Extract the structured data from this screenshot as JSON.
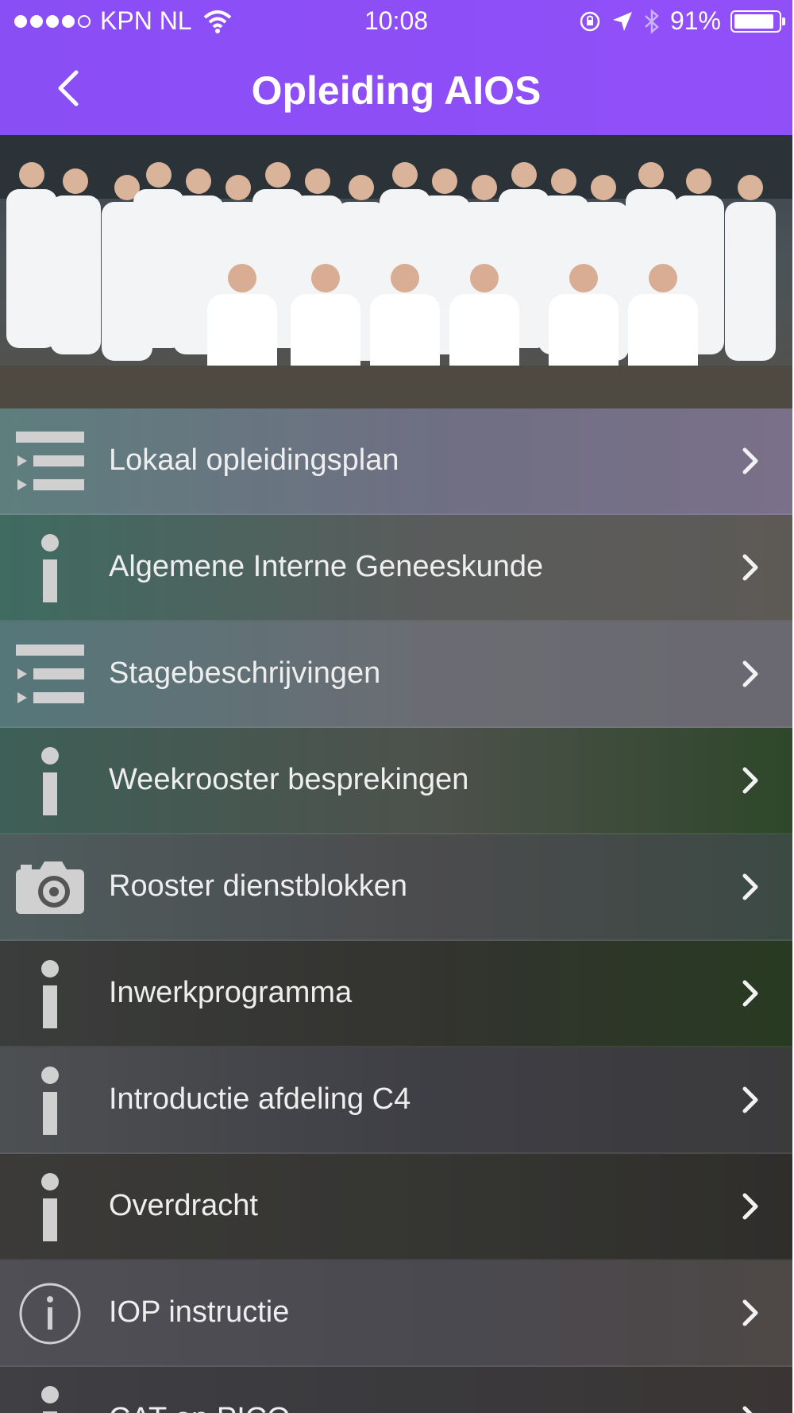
{
  "status_bar": {
    "carrier": "KPN NL",
    "time": "10:08",
    "battery_percent": "91%",
    "battery_level": 0.91,
    "signal_bars_filled": 4,
    "signal_bars_total": 5
  },
  "nav": {
    "title": "Opleiding AIOS"
  },
  "menu": {
    "items": [
      {
        "label": "Lokaal opleidingsplan",
        "icon": "list-icon"
      },
      {
        "label": "Algemene Interne Geneeskunde",
        "icon": "info-icon"
      },
      {
        "label": "Stagebeschrijvingen",
        "icon": "list-icon"
      },
      {
        "label": "Weekrooster besprekingen",
        "icon": "info-icon"
      },
      {
        "label": "Rooster dienstblokken",
        "icon": "camera-icon"
      },
      {
        "label": "Inwerkprogramma",
        "icon": "info-icon"
      },
      {
        "label": "Introductie afdeling C4",
        "icon": "info-icon"
      },
      {
        "label": "Overdracht",
        "icon": "info-icon"
      },
      {
        "label": "IOP instructie",
        "icon": "info-circle-icon"
      },
      {
        "label": "CAT en PICO",
        "icon": "info-icon"
      }
    ]
  },
  "colors": {
    "nav_purple": "#8e4ff7",
    "label_text": "#eeeeee",
    "icon_gray": "#d0d0d0"
  }
}
